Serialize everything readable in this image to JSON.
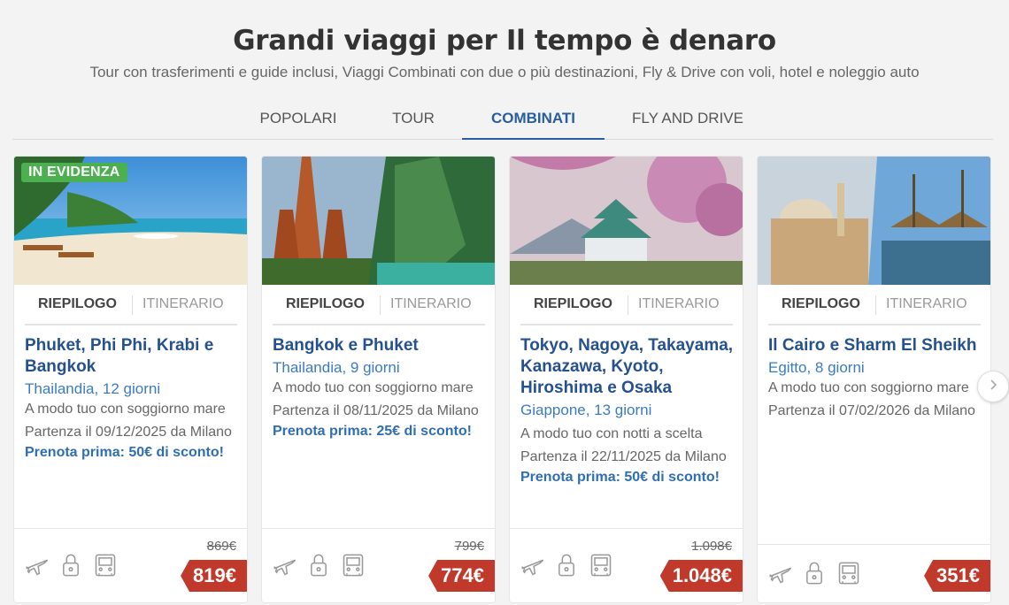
{
  "header": {
    "title": "Grandi viaggi per Il tempo è denaro",
    "subtitle": "Tour con trasferimenti e guide inclusi, Viaggi Combinati con due o più destinazioni, Fly & Drive con voli, hotel e noleggio auto"
  },
  "tabs": [
    {
      "label": "POPOLARI",
      "active": false
    },
    {
      "label": "TOUR",
      "active": false
    },
    {
      "label": "COMBINATI",
      "active": true
    },
    {
      "label": "FLY AND DRIVE",
      "active": false
    }
  ],
  "cards": [
    {
      "badge": "IN EVIDENZA",
      "subtab_summary": "RIEPILOGO",
      "subtab_itinerary": "ITINERARIO",
      "destinations": "Phuket, Phi Phi, Krabi e Bangkok",
      "country_days": "Thailandia, 12 giorni",
      "mode": "A modo tuo con soggiorno mare",
      "departure": "Partenza il 09/12/2025 da Milano",
      "promo": "Prenota prima: 50€ di sconto!",
      "old_price": "869€",
      "price": "819€",
      "icons": [
        "plane-icon",
        "lock-icon",
        "bus-icon"
      ]
    },
    {
      "badge": "",
      "subtab_summary": "RIEPILOGO",
      "subtab_itinerary": "ITINERARIO",
      "destinations": "Bangkok e Phuket",
      "country_days": "Thailandia, 9 giorni",
      "mode": "A modo tuo con soggiorno mare",
      "departure": "Partenza il 08/11/2025 da Milano",
      "promo": "Prenota prima: 25€ di sconto!",
      "old_price": "799€",
      "price": "774€",
      "icons": [
        "plane-icon",
        "lock-icon",
        "bus-icon"
      ]
    },
    {
      "badge": "",
      "subtab_summary": "RIEPILOGO",
      "subtab_itinerary": "ITINERARIO",
      "destinations": "Tokyo, Nagoya, Takayama, Kanazawa, Kyoto, Hiroshima e Osaka",
      "country_days": "Giappone, 13 giorni",
      "mode": "A modo tuo con notti a scelta",
      "departure": "Partenza il 22/11/2025 da Milano",
      "promo": "Prenota prima: 50€ di sconto!",
      "old_price": "1.098€",
      "price": "1.048€",
      "icons": [
        "plane-icon",
        "lock-icon",
        "bus-icon"
      ]
    },
    {
      "badge": "",
      "subtab_summary": "RIEPILOGO",
      "subtab_itinerary": "ITINERARIO",
      "destinations": "Il Cairo e Sharm El Sheikh",
      "country_days": "Egitto, 8 giorni",
      "mode": "A modo tuo con soggiorno mare",
      "departure": "Partenza il 07/02/2026 da Milano",
      "promo": "",
      "old_price": "",
      "price": "351€",
      "icons": [
        "plane-icon",
        "lock-icon",
        "bus-icon"
      ]
    }
  ],
  "colors": {
    "accent_blue": "#2a5d9f",
    "title_blue": "#25518e",
    "price_red": "#c0392b",
    "badge_green": "#4caf50"
  }
}
